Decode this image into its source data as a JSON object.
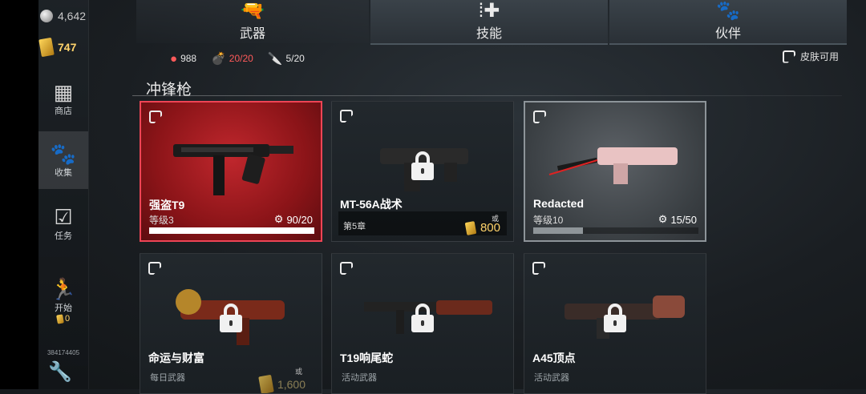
{
  "currency": {
    "coins": "4,642",
    "gold": "747"
  },
  "nav": [
    {
      "label": "商店",
      "icon": "chest-icon"
    },
    {
      "label": "收集",
      "icon": "gun-paw-icon"
    },
    {
      "label": "任务",
      "icon": "checklist-icon"
    },
    {
      "label": "开始",
      "icon": "runner-icon",
      "badge": "0"
    }
  ],
  "user_id": "384174405",
  "tabs": [
    {
      "label": "武器",
      "icon": "revolver-icon"
    },
    {
      "label": "技能",
      "icon": "ammo-plus-icon"
    },
    {
      "label": "伙伴",
      "icon": "paw-icon"
    }
  ],
  "stats": {
    "ammo": "988",
    "grenades": "20/20",
    "knives": "5/20"
  },
  "skin_available": "皮肤可用",
  "section_title": "冲锋枪",
  "cards": [
    {
      "name": "强盗T9",
      "level": "等级3",
      "parts": "90/20",
      "progress": 1.0,
      "state": "selected"
    },
    {
      "name": "MT-56A战术",
      "requirement": "第5章",
      "or": "或",
      "price": "800",
      "state": "locked"
    },
    {
      "name": "Redacted",
      "level": "等级10",
      "parts": "15/50",
      "progress": 0.3,
      "state": "owned"
    },
    {
      "name": "命运与财富",
      "sub": "每日武器",
      "or": "或",
      "price": "1,600",
      "state": "locked"
    },
    {
      "name": "T19响尾蛇",
      "sub": "活动武器",
      "state": "locked"
    },
    {
      "name": "A45顶点",
      "sub": "活动武器",
      "state": "locked"
    }
  ],
  "colors": {
    "accent_red": "#c0272d",
    "gold": "#ffd36b"
  }
}
